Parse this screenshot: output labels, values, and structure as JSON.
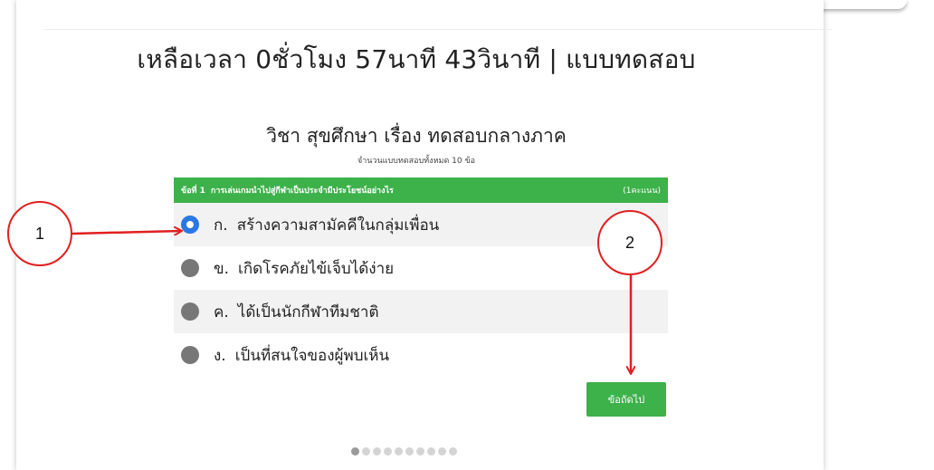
{
  "header": {
    "timer_title": "เหลือเวลา 0ชั่วโมง 57นาที 43วินาที | แบบทดสอบ"
  },
  "quiz": {
    "subject_title": "วิชา สุขศึกษา เรื่อง ทดสอบกลางภาค",
    "question_count_text": "จำนวนแบบทดสอบทั้งหมด 10 ข้อ",
    "question": {
      "number_label": "ข้อที่ 1",
      "text": "การเล่นเกมนำไปสู่กีฬาเป็นประจำมีประโยชน์อย่างไร",
      "score_label": "(1คะแนน)"
    },
    "options": [
      {
        "letter": "ก.",
        "text": "สร้างความสามัคคีในกลุ่มเพื่อน",
        "selected": true
      },
      {
        "letter": "ข.",
        "text": "เกิดโรคภัยไข้เจ็บได้ง่าย",
        "selected": false
      },
      {
        "letter": "ค.",
        "text": "ได้เป็นนักกีฬาทีมชาติ",
        "selected": false
      },
      {
        "letter": "ง.",
        "text": "เป็นที่สนใจของผู้พบเห็น",
        "selected": false
      }
    ],
    "next_button_label": "ข้อถัดไป",
    "pagination": {
      "total": 10,
      "current": 1
    }
  },
  "annotations": {
    "callout_1": "1",
    "callout_2": "2",
    "color": "#e02020"
  },
  "colors": {
    "accent_green": "#3db14a",
    "radio_selected": "#2a78e4",
    "radio_unselected": "#777777"
  }
}
